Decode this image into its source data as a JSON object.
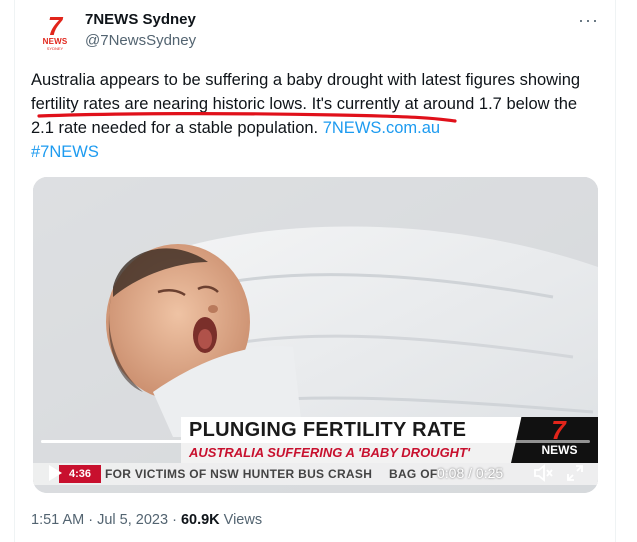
{
  "author": {
    "display_name": "7NEWS Sydney",
    "handle": "@7NewsSydney",
    "avatar": {
      "mark": "7",
      "brand": "NEWS",
      "city": "SYDNEY"
    },
    "more_icon": "more-horizontal-icon"
  },
  "tweet": {
    "text": "Australia appears to be suffering a baby drought with latest figures showing fertility rates are nearing historic lows. It's currently at around 1.7 below the 2.1 rate needed for a stable population. ",
    "link": "7NEWS.com.au",
    "hashtag": "#7NEWS"
  },
  "video": {
    "headline": "PLUNGING FERTILITY RATE",
    "subheadline": "AUSTRALIA SUFFERING A 'BABY DROUGHT'",
    "logo_mark": "7",
    "logo_word": "NEWS",
    "ticker_badge": "4:36",
    "ticker_text": "FOR VICTIMS OF NSW HUNTER BUS CRASH",
    "ticker_text_2": "BAG OF",
    "current_time": "0:08",
    "duration": "0:25",
    "time_display": "0:08 / 0:25",
    "progress_fraction": 0.32,
    "play_icon": "play-icon",
    "volume_icon": "volume-icon",
    "fullscreen_icon": "fullscreen-icon"
  },
  "meta": {
    "time": "1:51 AM",
    "separator": " · ",
    "date": "Jul 5, 2023",
    "views_count": "60.9K",
    "views_label": " Views"
  },
  "colors": {
    "link": "#1d9bf0",
    "brand_red": "#e1251b",
    "annotation_red": "#e0101a",
    "muted": "#536471"
  }
}
